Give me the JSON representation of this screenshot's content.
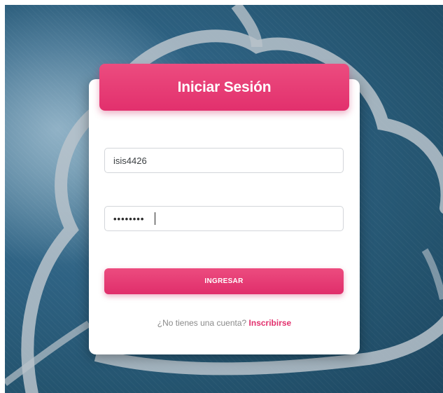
{
  "login": {
    "title": "Iniciar Sesión",
    "username_value": "isis4426",
    "password_value": "••••••••",
    "submit_label": "INGRESAR",
    "signup_prompt": "¿No tienes una cuenta?",
    "signup_link": "Inscribirse"
  },
  "colors": {
    "accent": "#e2306d",
    "background": "#2a5a78"
  }
}
